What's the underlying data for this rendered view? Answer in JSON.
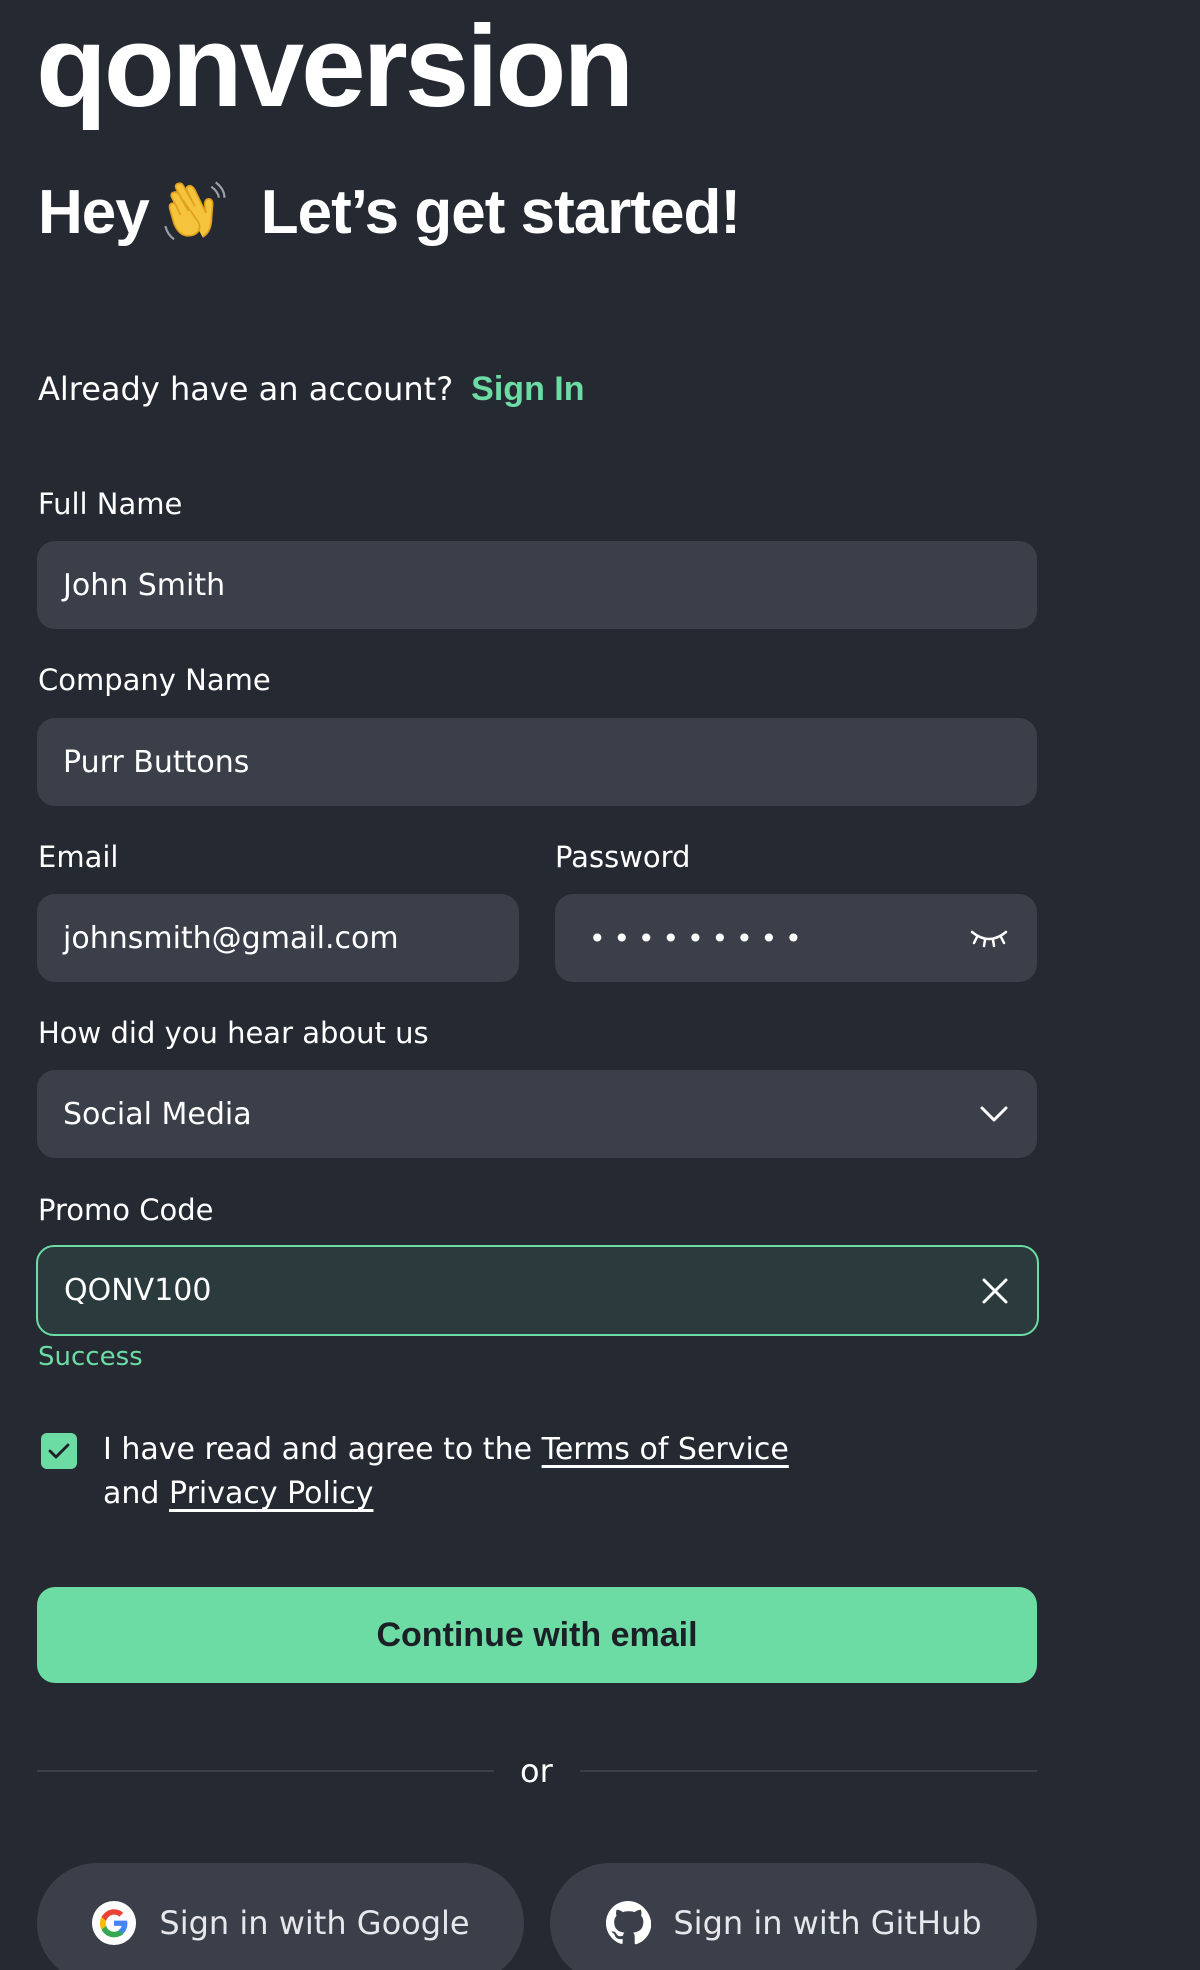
{
  "brand": {
    "logo_text": "qonversion"
  },
  "heading": {
    "hey": "Hey",
    "wave_icon": "waving-hand-icon",
    "tagline": "Let’s get started!"
  },
  "account": {
    "prompt": "Already have an account?",
    "signin_label": "Sign In"
  },
  "form": {
    "full_name": {
      "label": "Full Name",
      "value": "John Smith"
    },
    "company": {
      "label": "Company Name",
      "value": "Purr Buttons"
    },
    "email": {
      "label": "Email",
      "value": "johnsmith@gmail.com"
    },
    "password": {
      "label": "Password",
      "masked": "•••••••••",
      "toggle_icon": "eye-closed-icon"
    },
    "source": {
      "label": "How did you hear about us",
      "value": "Social Media",
      "icon": "chevron-down-icon"
    },
    "promo": {
      "label": "Promo Code",
      "value": "QONV100",
      "icon": "close-icon",
      "status": "Success"
    }
  },
  "terms": {
    "prefix": "I have read and agree to the",
    "tos_label": "Terms of Service",
    "and": "and",
    "privacy_label": "Privacy Policy",
    "checked": true
  },
  "actions": {
    "continue_label": "Continue with email",
    "or": "or",
    "google_label": "Sign in with Google",
    "github_label": "Sign in with GitHub"
  },
  "colors": {
    "background": "#252932",
    "field": "#3b3f49",
    "accent": "#6ddba4"
  }
}
